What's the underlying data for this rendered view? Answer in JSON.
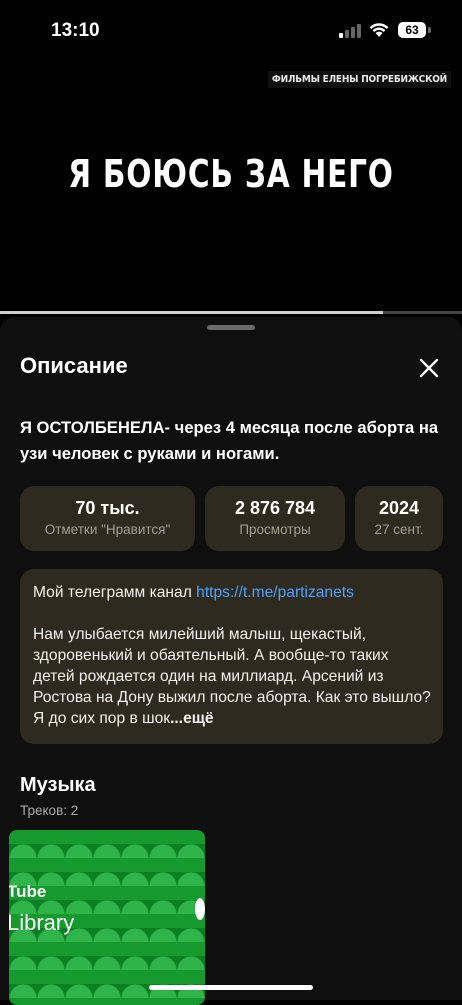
{
  "status": {
    "time": "13:10",
    "battery": "63"
  },
  "video": {
    "channel_tag": "ФИЛЬМЫ ЕЛЕНЫ ПОГРЕБИЖСКОЙ",
    "title": "Я БОЮСЬ ЗА НЕГО",
    "progress": 0.83
  },
  "sheet": {
    "title": "Описание",
    "heading": "Я ОСТОЛБЕНЕЛА-  через 4 месяца после аборта на узи человек с руками и ногами.",
    "stats": [
      {
        "value": "70 тыс.",
        "label": "Отметки \"Нравится\""
      },
      {
        "value": "2 876 784",
        "label": "Просмотры"
      },
      {
        "value": "2024",
        "label": "27 сент."
      }
    ],
    "description": {
      "line1_prefix": "Мой телеграмм канал ",
      "link": "https://t.me/partizanets",
      "body": "Нам улыбается милейший малыш, щекастый, здоровенький и обаятельный. А вообще-то таких детей рождается один на миллиард. Арсений из Ростова на Дону выжил после аборта. Как это вышло? Я до сих пор в шок",
      "more": "...ещё"
    },
    "music": {
      "title": "Музыка",
      "tracks": "Треков: 2",
      "card_text1": "Tube",
      "card_text2": "Library"
    }
  },
  "colors": {
    "panel": "#2f2a1f",
    "link": "#4aa3ff",
    "card_green": "#169a2e"
  }
}
